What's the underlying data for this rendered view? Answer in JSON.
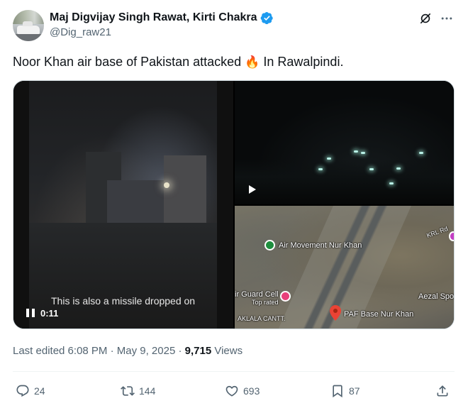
{
  "author": {
    "display_name": "Maj Digvijay Singh Rawat, Kirti Chakra",
    "handle": "@Dig_raw21",
    "verified": true
  },
  "tweet": {
    "text_before": "Noor Khan air base of Pakistan attacked ",
    "emoji": "🔥",
    "text_after": " In Rawalpindi."
  },
  "media": {
    "video1": {
      "caption": "This is also a missile dropped on",
      "time": "0:11",
      "state": "playing"
    },
    "video2": {
      "state": "paused"
    },
    "map_labels": {
      "air_movement": "Air Movement Nur Khan",
      "air_guard": "ir Guard Cell",
      "top_rated": "Top rated",
      "paf_base": "PAF Base Nur Khan",
      "chaklala": "AKLALA CANTT.",
      "aezal": "Aezal Spot",
      "krl": "KRL Rd"
    }
  },
  "meta": {
    "edited": "Last edited 6:08 PM · May 9, 2025 · ",
    "views_count": "9,715",
    "views_label": " Views"
  },
  "actions": {
    "replies": "24",
    "reposts": "144",
    "likes": "693",
    "bookmarks": "87"
  },
  "colors": {
    "text": "#0f1419",
    "secondary": "#536471",
    "verified_blue": "#1d9bf0"
  }
}
